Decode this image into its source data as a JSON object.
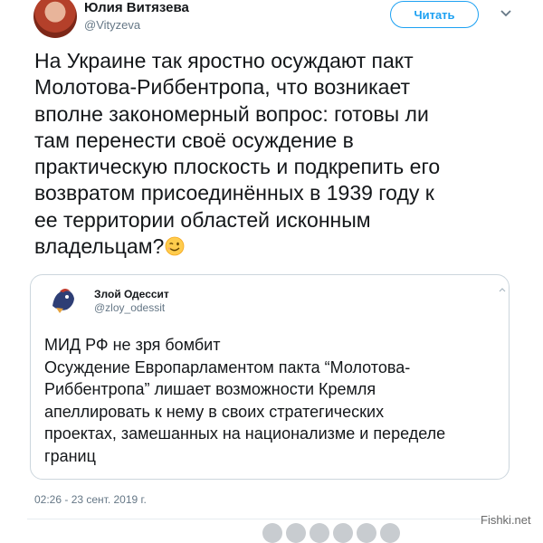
{
  "author": {
    "name": "Юлия Витязева",
    "handle": "@Vityzeva"
  },
  "follow_label": "Читать",
  "tweet_lines": [
    "На Украине так яростно осуждают пакт",
    "Молотова-Риббентропа, что возникает",
    "вполне закономерный вопрос: готовы ли",
    "там перенести своё осуждение в",
    "практическую плоскость и подкрепить его",
    "возвратом присоединённых в 1939 году к",
    "ее территории областей исконным",
    "владельцам?"
  ],
  "quoted": {
    "name": "Злой Одессит",
    "handle": "@zloy_odessit",
    "lines": [
      "МИД РФ не зря бомбит",
      "Осуждение Европарламентом пакта “Молотова-",
      "Риббентропа” лишает возможности Кремля",
      "апеллировать к нему в своих стратегических",
      "проектах, замешанных на национализме и переделе",
      "границ"
    ]
  },
  "timestamp": "02:26 - 23 сент. 2019 г.",
  "watermark": "Fishki.net",
  "icons": {
    "emoji": "winking-face",
    "caret": "chevron-down"
  }
}
